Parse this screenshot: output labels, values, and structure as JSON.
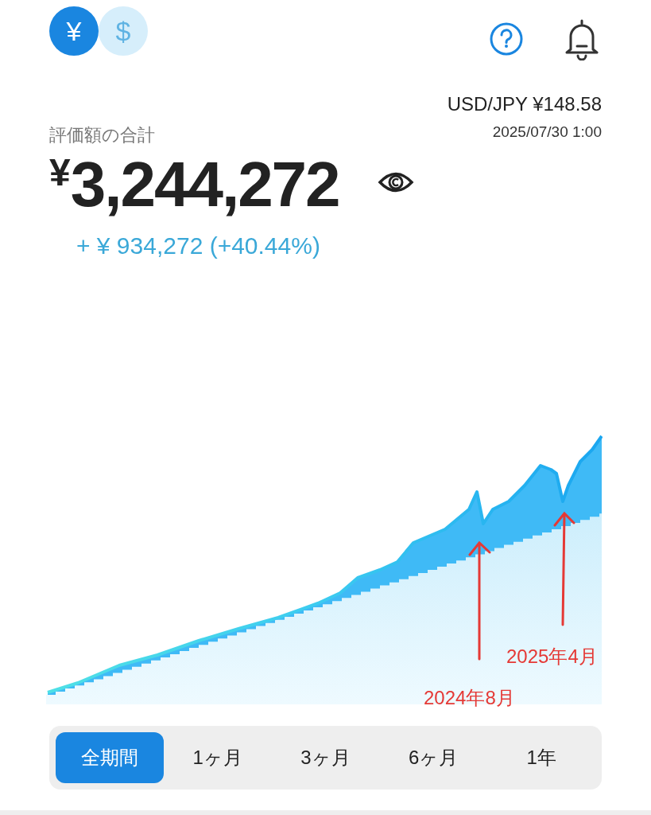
{
  "currency_toggle": [
    {
      "symbol": "¥",
      "selected": true
    },
    {
      "symbol": "$",
      "selected": false
    }
  ],
  "rate": {
    "pair": "USD/JPY ¥148.58",
    "timestamp": "2025/07/30 1:00"
  },
  "total": {
    "label": "評価額の合計",
    "value": "$^{¥}$3,244,272",
    "change": "+ ¥ 934,272 (+40.44%)"
  },
  "annotations": [
    {
      "text": "2025年4月"
    },
    {
      "text": "2024年8月"
    }
  ],
  "periods": [
    {
      "label": "全期間",
      "selected": true
    },
    {
      "label": "1ヶ月",
      "selected": false
    },
    {
      "label": "3ヶ月",
      "selected": false
    },
    {
      "label": "6ヶ月",
      "selected": false
    },
    {
      "label": "1年",
      "selected": false
    }
  ]
}
